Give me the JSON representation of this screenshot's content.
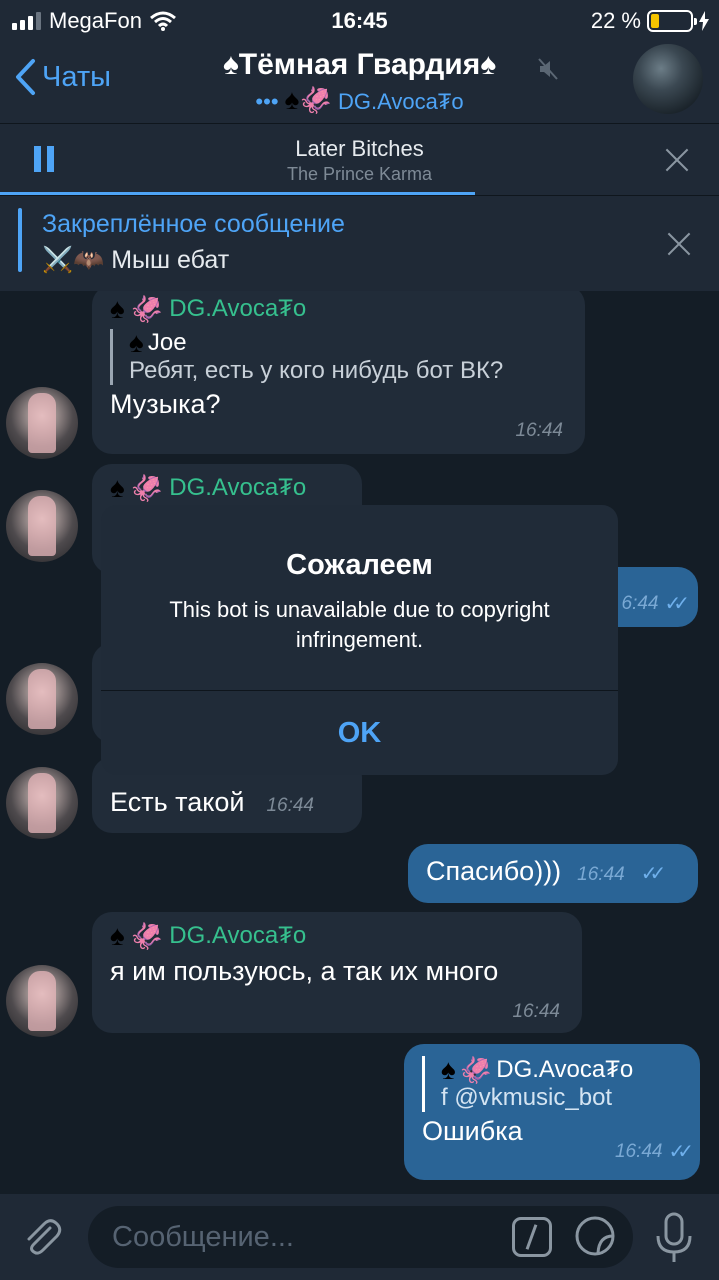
{
  "status_bar": {
    "carrier": "MegaFon",
    "time": "16:45",
    "battery_percent_text": "22 %",
    "battery_level": 0.22
  },
  "header": {
    "back_label": "Чаты",
    "title": "♠Тёмная Гвардия♠",
    "subtitle_dots": "•••",
    "subtitle_user": "DG.Avoca₮o"
  },
  "player": {
    "track": "Later Bitches",
    "artist": "The Prince Karma",
    "progress": 0.66
  },
  "pinned": {
    "title": "Закреплённое сообщение",
    "text": "Мыш ебат",
    "emoji": "⚔️🦇"
  },
  "messages": [
    {
      "sender": "DG.Avoca₮o",
      "reply_name": "Joe",
      "reply_text": "Ребят, есть у кого нибудь бот ВК?",
      "text": "Музыка?",
      "time": "16:44"
    },
    {
      "sender": "DG.Avoca₮o"
    },
    {
      "time_partial": "6:44"
    },
    {
      "text": "Есть такой",
      "time": "16:44"
    },
    {
      "text": "Спасибо)))",
      "time": "16:44"
    },
    {
      "sender": "DG.Avoca₮o",
      "text": "я им пользуюсь, а так их много",
      "time": "16:44"
    },
    {
      "reply_name": "DG.Avoca₮o",
      "reply_text": "f @vkmusic_bot",
      "text": "Ошибка",
      "time": "16:44"
    }
  ],
  "dialog": {
    "title": "Сожалеем",
    "message": "This bot is unavailable due to copyright infringement.",
    "ok_label": "OK"
  },
  "input": {
    "placeholder": "Сообщение..."
  },
  "colors": {
    "accent": "#4ea4f6",
    "sender_green": "#36c08e",
    "outgoing_bubble": "#2a6496",
    "incoming_bubble": "#212c39",
    "background": "#141d26"
  }
}
